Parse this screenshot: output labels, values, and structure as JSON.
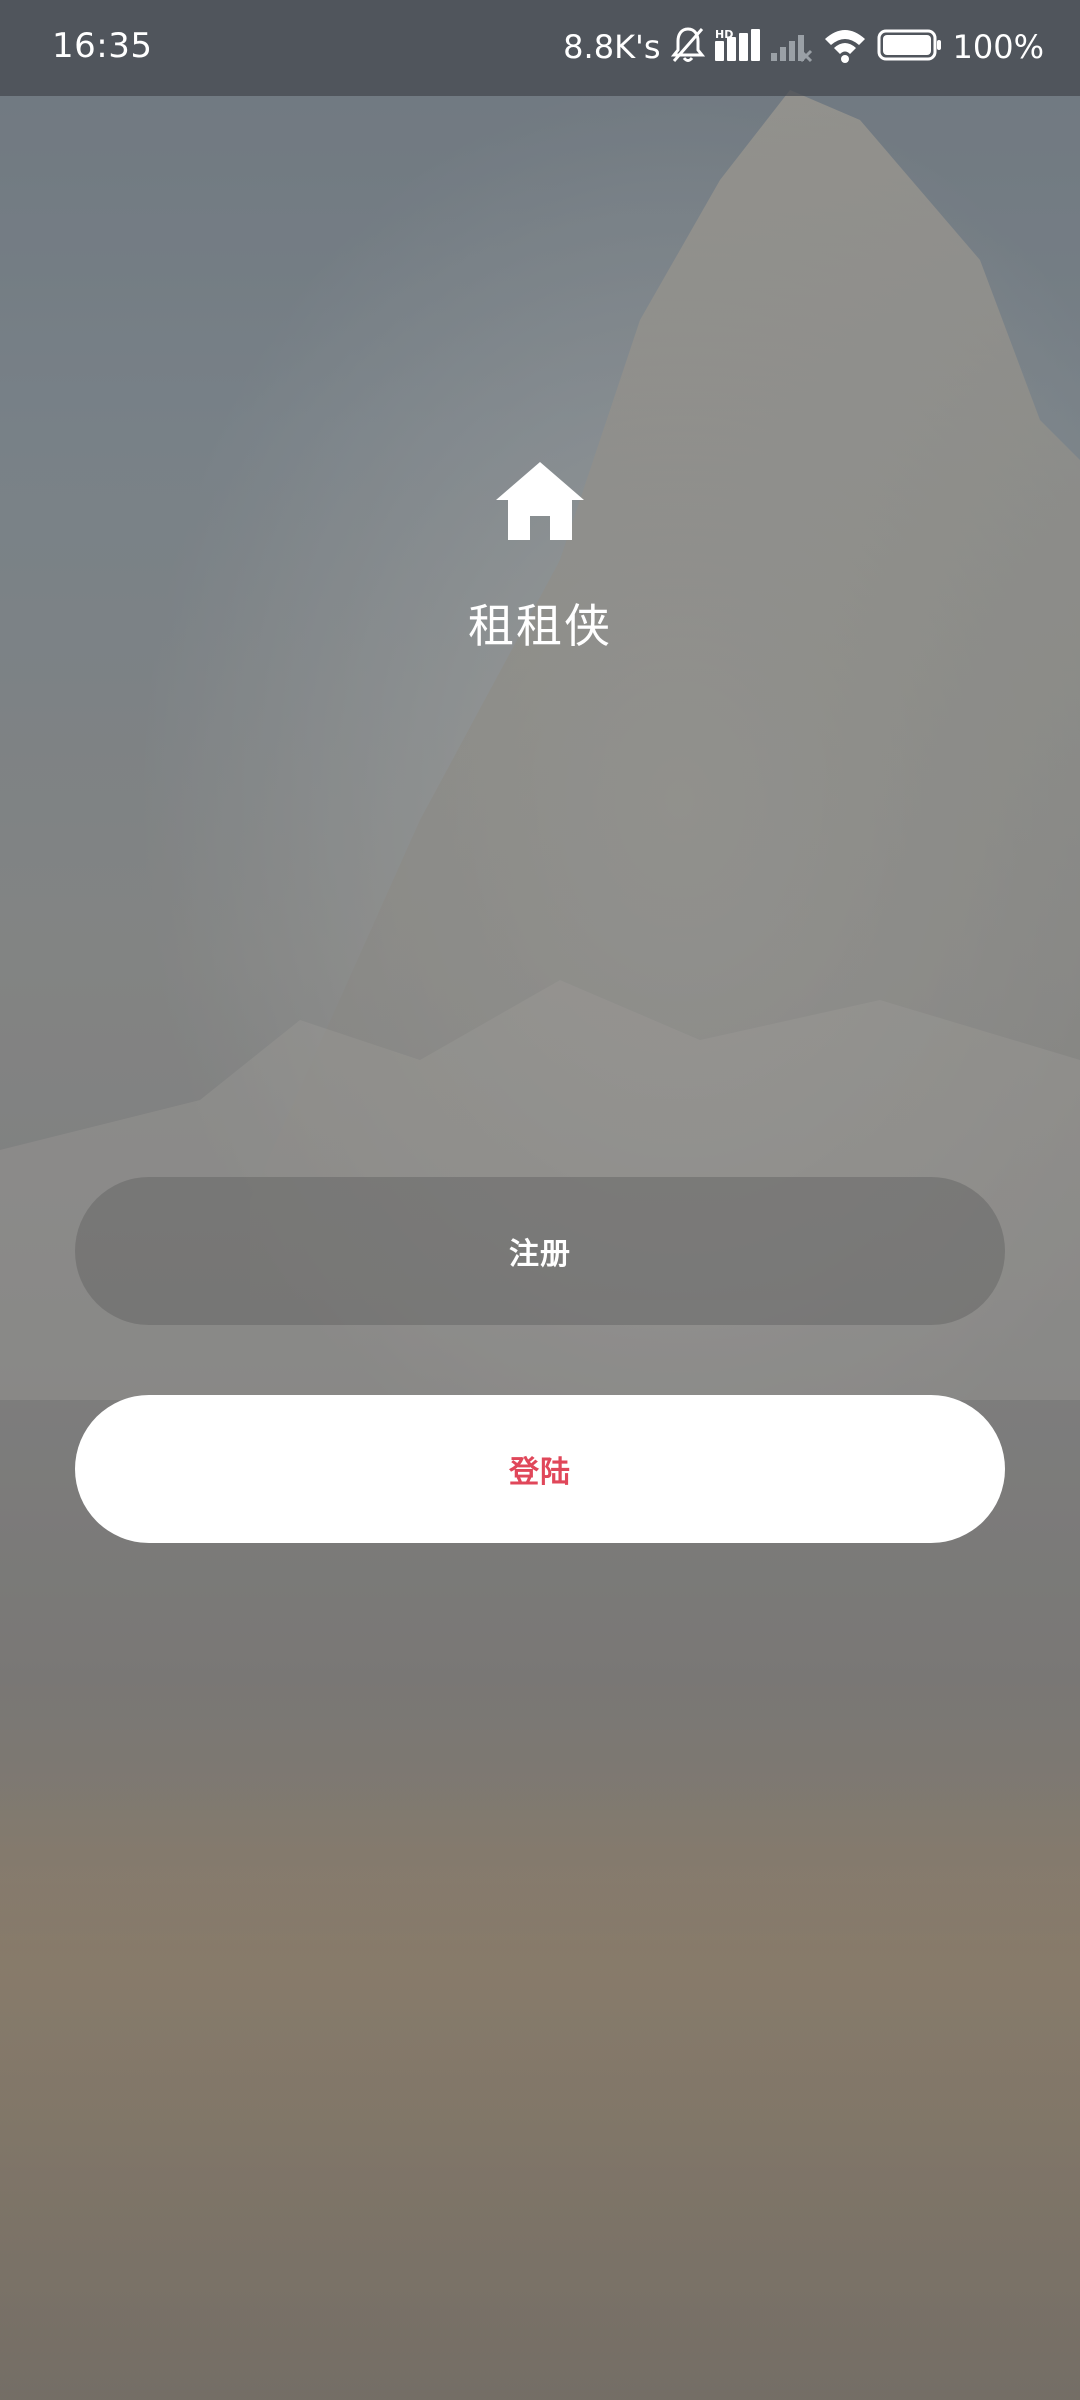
{
  "status_bar": {
    "time": "16:35",
    "net_speed": "8.8K's",
    "battery_percent": "100%",
    "icons": [
      "bell-muted-icon",
      "hd-signal-icon",
      "cell-signal-icon",
      "wifi-icon",
      "battery-icon"
    ]
  },
  "app": {
    "logo_icon": "home-icon",
    "name": "租租侠"
  },
  "actions": {
    "register_label": "注册",
    "login_label": "登陆"
  },
  "colors": {
    "login_text": "#e0475a",
    "button_white": "#ffffff"
  }
}
